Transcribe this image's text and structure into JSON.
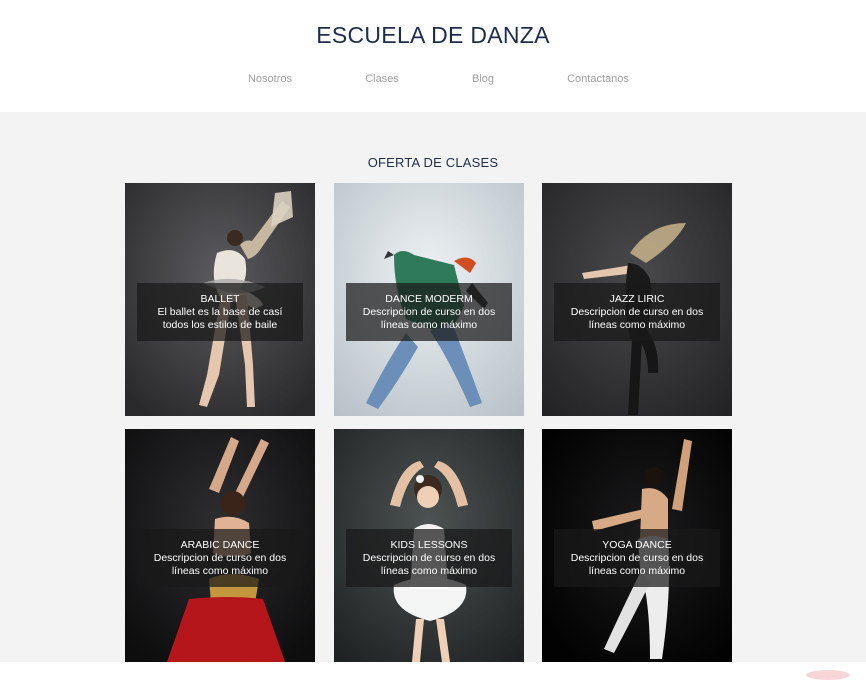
{
  "header": {
    "title": "ESCUELA DE DANZA",
    "nav": [
      {
        "label": "Nosotros"
      },
      {
        "label": "Clases"
      },
      {
        "label": "Blog"
      },
      {
        "label": "Contactanos"
      }
    ]
  },
  "main": {
    "section_title": "OFERTA DE CLASES",
    "classes": [
      {
        "title": "BALLET",
        "description": "El ballet es la base de casí todos los estilos de baile"
      },
      {
        "title": "DANCE MODERM",
        "description": "Descripcion de curso en dos líneas como máximo"
      },
      {
        "title": "JAZZ LIRIC",
        "description": "Descripcion de curso en dos líneas como máximo"
      },
      {
        "title": "ARABIC DANCE",
        "description": "Descripcion de curso en dos líneas como máximo"
      },
      {
        "title": "KIDS LESSONS",
        "description": "Descripcion de curso en dos líneas como máximo"
      },
      {
        "title": "YOGA DANCE",
        "description": "Descripcion de curso en dos líneas como máximo"
      }
    ]
  },
  "colors": {
    "title": "#1f2d4d",
    "nav": "#a0a0a0",
    "section_bg": "#f3f3f3",
    "caption_bg": "#191919"
  }
}
